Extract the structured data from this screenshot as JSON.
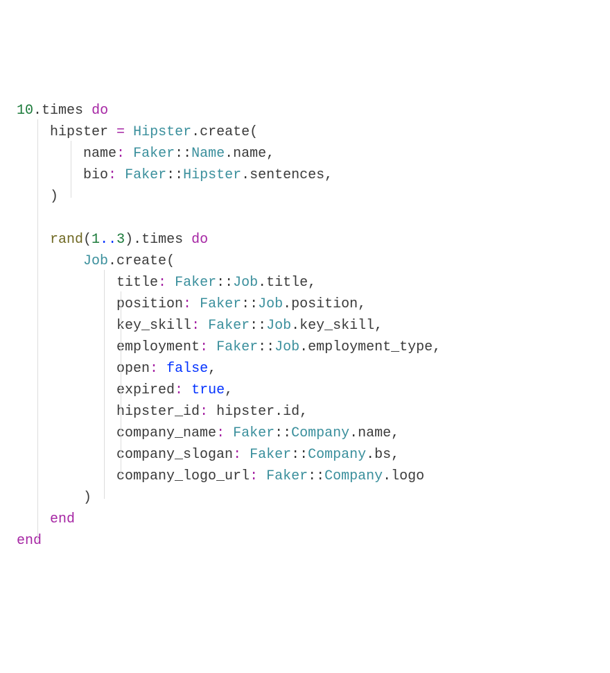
{
  "code": {
    "tokens": [
      [
        {
          "c": "num",
          "t": "10"
        },
        {
          "c": "punc",
          "t": "."
        },
        {
          "c": "plain",
          "t": "times"
        },
        {
          "c": "plain",
          "t": " "
        },
        {
          "c": "kw",
          "t": "do"
        }
      ],
      [
        {
          "c": "plain",
          "t": "    hipster "
        },
        {
          "c": "assign",
          "t": "="
        },
        {
          "c": "plain",
          "t": " "
        },
        {
          "c": "cls",
          "t": "Hipster"
        },
        {
          "c": "punc",
          "t": "."
        },
        {
          "c": "plain",
          "t": "create"
        },
        {
          "c": "punc",
          "t": "("
        }
      ],
      [
        {
          "c": "plain",
          "t": "        "
        },
        {
          "c": "sym",
          "t": "name"
        },
        {
          "c": "colon",
          "t": ":"
        },
        {
          "c": "plain",
          "t": " "
        },
        {
          "c": "const",
          "t": "Faker"
        },
        {
          "c": "punc",
          "t": "::"
        },
        {
          "c": "const",
          "t": "Name"
        },
        {
          "c": "punc",
          "t": "."
        },
        {
          "c": "plain",
          "t": "name"
        },
        {
          "c": "punc",
          "t": ","
        }
      ],
      [
        {
          "c": "plain",
          "t": "        "
        },
        {
          "c": "sym",
          "t": "bio"
        },
        {
          "c": "colon",
          "t": ":"
        },
        {
          "c": "plain",
          "t": " "
        },
        {
          "c": "const",
          "t": "Faker"
        },
        {
          "c": "punc",
          "t": "::"
        },
        {
          "c": "const",
          "t": "Hipster"
        },
        {
          "c": "punc",
          "t": "."
        },
        {
          "c": "plain",
          "t": "sentences"
        },
        {
          "c": "punc",
          "t": ","
        }
      ],
      [
        {
          "c": "plain",
          "t": "    "
        },
        {
          "c": "punc",
          "t": ")"
        }
      ],
      [
        {
          "c": "plain",
          "t": " "
        }
      ],
      [
        {
          "c": "plain",
          "t": "    "
        },
        {
          "c": "fn",
          "t": "rand"
        },
        {
          "c": "punc",
          "t": "("
        },
        {
          "c": "num",
          "t": "1"
        },
        {
          "c": "range",
          "t": ".."
        },
        {
          "c": "num",
          "t": "3"
        },
        {
          "c": "punc",
          "t": ")"
        },
        {
          "c": "punc",
          "t": "."
        },
        {
          "c": "plain",
          "t": "times"
        },
        {
          "c": "plain",
          "t": " "
        },
        {
          "c": "kw",
          "t": "do"
        }
      ],
      [
        {
          "c": "plain",
          "t": "        "
        },
        {
          "c": "cls",
          "t": "Job"
        },
        {
          "c": "punc",
          "t": "."
        },
        {
          "c": "plain",
          "t": "create"
        },
        {
          "c": "punc",
          "t": "("
        }
      ],
      [
        {
          "c": "plain",
          "t": "            "
        },
        {
          "c": "sym",
          "t": "title"
        },
        {
          "c": "colon",
          "t": ":"
        },
        {
          "c": "plain",
          "t": " "
        },
        {
          "c": "const",
          "t": "Faker"
        },
        {
          "c": "punc",
          "t": "::"
        },
        {
          "c": "const",
          "t": "Job"
        },
        {
          "c": "punc",
          "t": "."
        },
        {
          "c": "plain",
          "t": "title"
        },
        {
          "c": "punc",
          "t": ","
        }
      ],
      [
        {
          "c": "plain",
          "t": "            "
        },
        {
          "c": "sym",
          "t": "position"
        },
        {
          "c": "colon",
          "t": ":"
        },
        {
          "c": "plain",
          "t": " "
        },
        {
          "c": "const",
          "t": "Faker"
        },
        {
          "c": "punc",
          "t": "::"
        },
        {
          "c": "const",
          "t": "Job"
        },
        {
          "c": "punc",
          "t": "."
        },
        {
          "c": "plain",
          "t": "position,"
        }
      ],
      [
        {
          "c": "plain",
          "t": "            "
        },
        {
          "c": "sym",
          "t": "key_skill"
        },
        {
          "c": "colon",
          "t": ":"
        },
        {
          "c": "plain",
          "t": " "
        },
        {
          "c": "const",
          "t": "Faker"
        },
        {
          "c": "punc",
          "t": "::"
        },
        {
          "c": "const",
          "t": "Job"
        },
        {
          "c": "punc",
          "t": "."
        },
        {
          "c": "plain",
          "t": "key_skill,"
        }
      ],
      [
        {
          "c": "plain",
          "t": "            "
        },
        {
          "c": "sym",
          "t": "employment"
        },
        {
          "c": "colon",
          "t": ":"
        },
        {
          "c": "plain",
          "t": " "
        },
        {
          "c": "const",
          "t": "Faker"
        },
        {
          "c": "punc",
          "t": "::"
        },
        {
          "c": "const",
          "t": "Job"
        },
        {
          "c": "punc",
          "t": "."
        },
        {
          "c": "plain",
          "t": "employment_type,"
        }
      ],
      [
        {
          "c": "plain",
          "t": "            "
        },
        {
          "c": "sym",
          "t": "open"
        },
        {
          "c": "colon",
          "t": ":"
        },
        {
          "c": "plain",
          "t": " "
        },
        {
          "c": "bool",
          "t": "false"
        },
        {
          "c": "punc",
          "t": ","
        }
      ],
      [
        {
          "c": "plain",
          "t": "            "
        },
        {
          "c": "sym",
          "t": "expired"
        },
        {
          "c": "colon",
          "t": ":"
        },
        {
          "c": "plain",
          "t": " "
        },
        {
          "c": "bool",
          "t": "true"
        },
        {
          "c": "punc",
          "t": ","
        }
      ],
      [
        {
          "c": "plain",
          "t": "            "
        },
        {
          "c": "sym",
          "t": "hipster_id"
        },
        {
          "c": "colon",
          "t": ":"
        },
        {
          "c": "plain",
          "t": " hipster"
        },
        {
          "c": "punc",
          "t": "."
        },
        {
          "c": "plain",
          "t": "id,"
        }
      ],
      [
        {
          "c": "plain",
          "t": "            "
        },
        {
          "c": "sym",
          "t": "company_name"
        },
        {
          "c": "colon",
          "t": ":"
        },
        {
          "c": "plain",
          "t": " "
        },
        {
          "c": "const",
          "t": "Faker"
        },
        {
          "c": "punc",
          "t": "::"
        },
        {
          "c": "const",
          "t": "Company"
        },
        {
          "c": "punc",
          "t": "."
        },
        {
          "c": "plain",
          "t": "name,"
        }
      ],
      [
        {
          "c": "plain",
          "t": "            "
        },
        {
          "c": "sym",
          "t": "company_slogan"
        },
        {
          "c": "colon",
          "t": ":"
        },
        {
          "c": "plain",
          "t": " "
        },
        {
          "c": "const",
          "t": "Faker"
        },
        {
          "c": "punc",
          "t": "::"
        },
        {
          "c": "const",
          "t": "Company"
        },
        {
          "c": "punc",
          "t": "."
        },
        {
          "c": "plain",
          "t": "bs,"
        }
      ],
      [
        {
          "c": "plain",
          "t": "            "
        },
        {
          "c": "sym",
          "t": "company_logo_url"
        },
        {
          "c": "colon",
          "t": ":"
        },
        {
          "c": "plain",
          "t": " "
        },
        {
          "c": "const",
          "t": "Faker"
        },
        {
          "c": "punc",
          "t": "::"
        },
        {
          "c": "const",
          "t": "Company"
        },
        {
          "c": "punc",
          "t": "."
        },
        {
          "c": "plain",
          "t": "logo"
        }
      ],
      [
        {
          "c": "plain",
          "t": "        "
        },
        {
          "c": "punc",
          "t": ")"
        }
      ],
      [
        {
          "c": "plain",
          "t": "    "
        },
        {
          "c": "kw",
          "t": "end"
        }
      ],
      [
        {
          "c": "kw",
          "t": "end"
        }
      ]
    ],
    "guides": [
      {
        "col": 2.5,
        "from": 0,
        "to": 20
      },
      {
        "col": 6.5,
        "from": 1,
        "to": 4
      },
      {
        "col": 10.5,
        "from": 7,
        "to": 18
      },
      {
        "col": 12.5,
        "from": 8,
        "to": 17
      }
    ]
  }
}
